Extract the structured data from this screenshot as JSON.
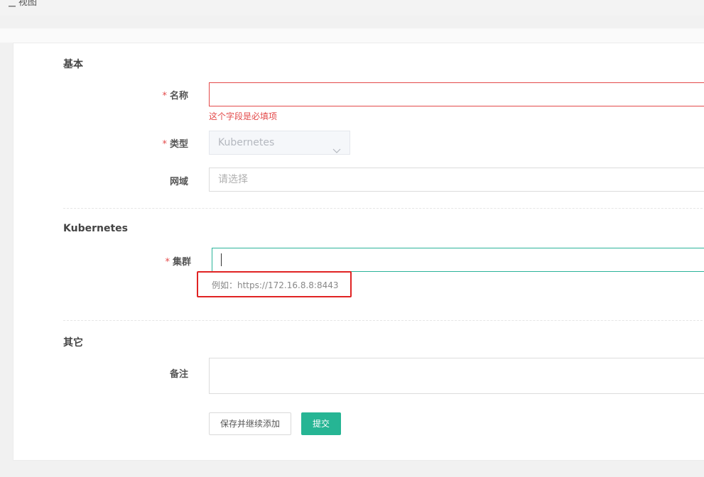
{
  "header": {
    "crumb": "视图"
  },
  "sections": {
    "basic": "基本",
    "kubernetes": "Kubernetes",
    "other": "其它"
  },
  "form": {
    "name": {
      "label": "名称",
      "required_mark": "*",
      "value": "",
      "error": "这个字段是必填项"
    },
    "type": {
      "label": "类型",
      "required_mark": "*",
      "value": "Kubernetes"
    },
    "domain": {
      "label": "网域",
      "placeholder": "请选择"
    },
    "cluster": {
      "label": "集群",
      "required_mark": "*",
      "value": "",
      "hint": "例如：https://172.16.8.8:8443"
    },
    "remark": {
      "label": "备注",
      "value": ""
    }
  },
  "buttons": {
    "save_continue": "保存并继续添加",
    "submit": "提交"
  },
  "colors": {
    "error": "#e34a4a",
    "accent": "#26b594",
    "highlight": "#e02323"
  }
}
